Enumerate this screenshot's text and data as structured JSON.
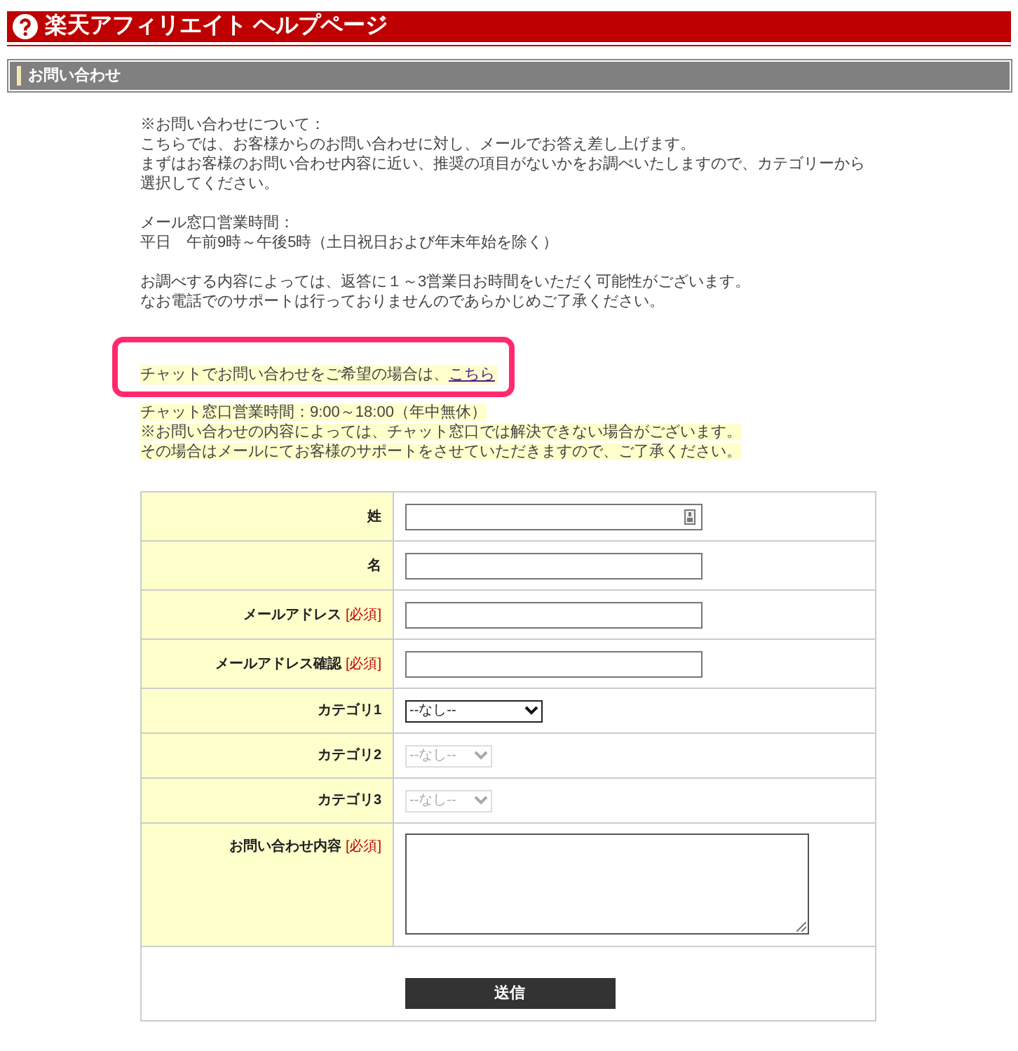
{
  "header": {
    "title": "楽天アフィリエイト ヘルプページ"
  },
  "section": {
    "title": "お問い合わせ"
  },
  "intro": [
    [
      "※お問い合わせについて：",
      "こちらでは、お客様からのお問い合わせに対し、メールでお答え差し上げます。",
      "まずはお客様のお問い合わせ内容に近い、推奨の項目がないかをお調べいたしますので、カテゴリーから選択してください。"
    ],
    [
      "メール窓口営業時間：",
      "平日　午前9時～午後5時（土日祝日および年末年始を除く）"
    ],
    [
      "お調べする内容によっては、返答に１～3営業日お時間をいただく可能性がございます。",
      "なお電話でのサポートは行っておりませんのであらかじめご了承ください。"
    ]
  ],
  "chat": {
    "text": "チャットでお問い合わせをご希望の場合は、",
    "link": "こちら",
    "notes": [
      "チャット窓口営業時間：9:00～18:00（年中無休）",
      "※お問い合わせの内容によっては、チャット窓口では解決できない場合がございます。",
      "その場合はメールにてお客様のサポートをさせていただきますので、ご了承ください。"
    ]
  },
  "form": {
    "fields": [
      {
        "label": "姓",
        "kind": "text",
        "autofill": true
      },
      {
        "label": "名",
        "kind": "text",
        "autofill": false
      },
      {
        "label": "メールアドレス",
        "kind": "text",
        "required_label": "[必須]",
        "autofill": false
      },
      {
        "label": "メールアドレス確認",
        "kind": "text",
        "required_label": "[必須]",
        "autofill": false
      },
      {
        "label": "カテゴリ1",
        "kind": "select",
        "value": "--なし--",
        "disabled": false
      },
      {
        "label": "カテゴリ2",
        "kind": "select",
        "value": "--なし--",
        "disabled": true
      },
      {
        "label": "カテゴリ3",
        "kind": "select",
        "value": "--なし--",
        "disabled": true
      },
      {
        "label": "お問い合わせ内容",
        "kind": "textarea",
        "required_label": "[必須]"
      }
    ],
    "submit": "送信"
  }
}
